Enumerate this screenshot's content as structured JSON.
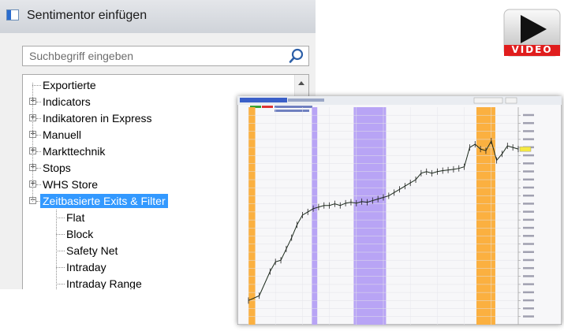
{
  "dialog": {
    "title": "Sentimentor einfügen",
    "icon": "window-icon",
    "search": {
      "placeholder": "Suchbegriff eingeben",
      "value": "",
      "icon": "search-icon"
    },
    "tree": [
      {
        "label": "Exportierte",
        "level": 0,
        "expander": null,
        "selected": false
      },
      {
        "label": "Indicators",
        "level": 0,
        "expander": "+",
        "selected": false
      },
      {
        "label": "Indikatoren in Express",
        "level": 0,
        "expander": "+",
        "selected": false
      },
      {
        "label": "Manuell",
        "level": 0,
        "expander": "+",
        "selected": false
      },
      {
        "label": "Markttechnik",
        "level": 0,
        "expander": "+",
        "selected": false
      },
      {
        "label": "Stops",
        "level": 0,
        "expander": "+",
        "selected": false
      },
      {
        "label": "WHS Store",
        "level": 0,
        "expander": "+",
        "selected": false
      },
      {
        "label": "Zeitbasierte Exits & Filter",
        "level": 0,
        "expander": "-",
        "selected": true
      },
      {
        "label": "Flat",
        "level": 1,
        "expander": null,
        "selected": false
      },
      {
        "label": "Block",
        "level": 1,
        "expander": null,
        "selected": false
      },
      {
        "label": "Safety Net",
        "level": 1,
        "expander": null,
        "selected": false
      },
      {
        "label": "Intraday",
        "level": 1,
        "expander": null,
        "selected": false
      },
      {
        "label": "Intraday Range",
        "level": 1,
        "expander": null,
        "selected": false
      }
    ]
  },
  "video_badge": {
    "label": "VIDEO",
    "icon": "play-icon",
    "color": "#e01d1d"
  },
  "chart_thumbnail": {
    "highlight_colors": {
      "orange": "#fbb040",
      "purple": "#b8a4f5"
    }
  },
  "chart_data": {
    "type": "line",
    "x": [
      0,
      4,
      8,
      10,
      12,
      14,
      16,
      18,
      20,
      22,
      24,
      26,
      28,
      30,
      32,
      34,
      36,
      38,
      40,
      42,
      44,
      46,
      48,
      50,
      52,
      54,
      56,
      58,
      60,
      62,
      64,
      66,
      68,
      70,
      72,
      74,
      76,
      78,
      80,
      82,
      84,
      86,
      88,
      90,
      92,
      94,
      96,
      98,
      100
    ],
    "series": [
      {
        "values": [
          4225,
          4240,
          4315,
          4345,
          4350,
          4385,
          4420,
          4460,
          4490,
          4500,
          4510,
          4515,
          4520,
          4520,
          4525,
          4520,
          4527,
          4530,
          4527,
          4532,
          4530,
          4535,
          4540,
          4545,
          4550,
          4560,
          4570,
          4580,
          4590,
          4600,
          4620,
          4625,
          4620,
          4625,
          4628,
          4630,
          4632,
          4635,
          4640,
          4700,
          4710,
          4695,
          4690,
          4720,
          4660,
          4680,
          4705,
          4700,
          4695
        ]
      }
    ],
    "highlighted_ranges": [
      {
        "x_start": 0,
        "x_end": 2.5,
        "color": "orange"
      },
      {
        "x_start": 23.5,
        "x_end": 25.5,
        "color": "purple"
      },
      {
        "x_start": 39,
        "x_end": 51,
        "color": "purple"
      },
      {
        "x_start": 84.5,
        "x_end": 91.5,
        "color": "orange"
      }
    ],
    "ylim": [
      4150,
      4825
    ],
    "grid": true
  }
}
